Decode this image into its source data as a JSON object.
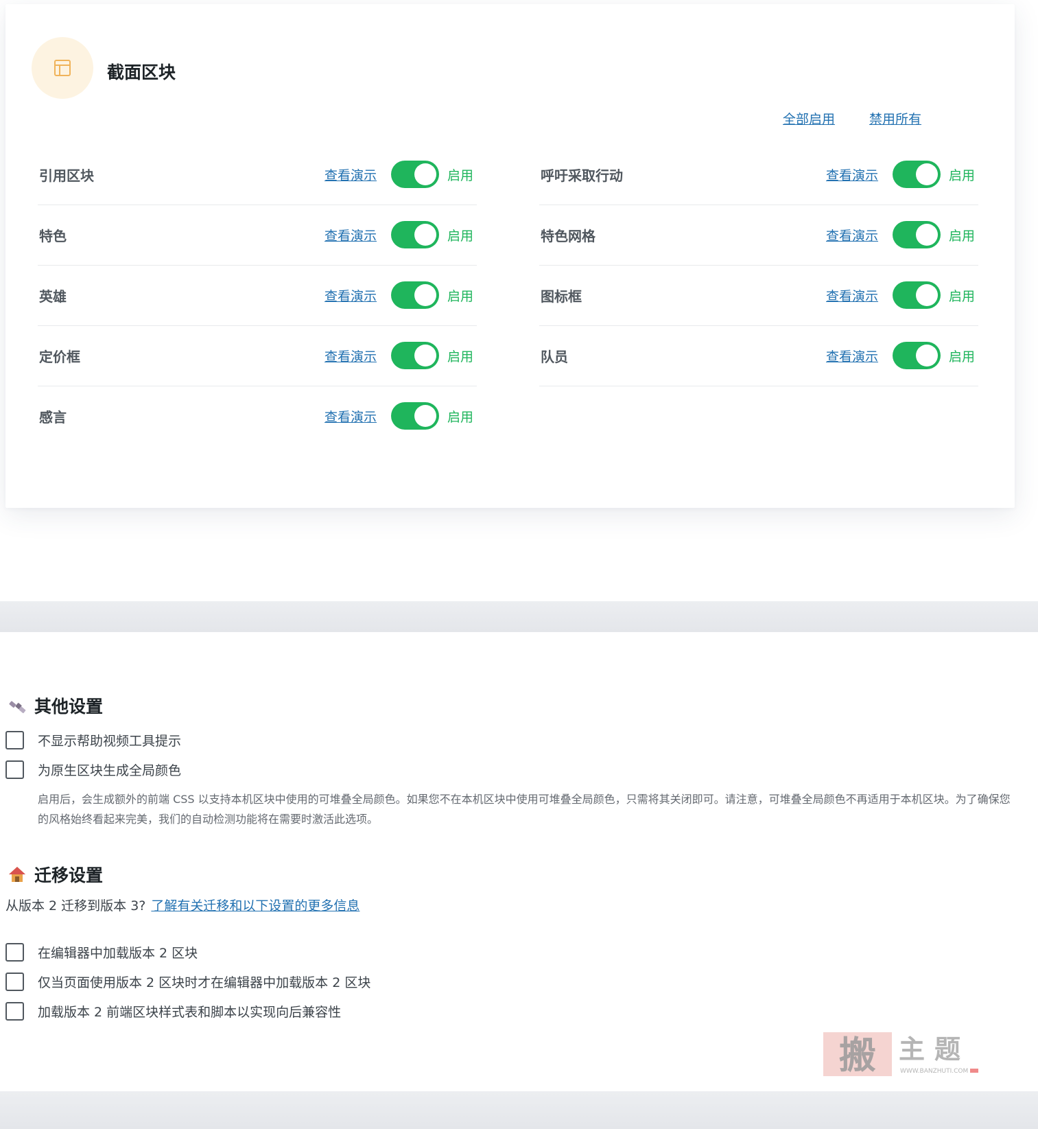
{
  "section_blocks": {
    "title": "截面区块",
    "enable_all": "全部启用",
    "disable_all": "禁用所有",
    "left_blocks": [
      {
        "label": "引用区块",
        "demo": "查看演示",
        "state": "启用",
        "enabled": true
      },
      {
        "label": "特色",
        "demo": "查看演示",
        "state": "启用",
        "enabled": true
      },
      {
        "label": "英雄",
        "demo": "查看演示",
        "state": "启用",
        "enabled": true
      },
      {
        "label": "定价框",
        "demo": "查看演示",
        "state": "启用",
        "enabled": true
      },
      {
        "label": "感言",
        "demo": "查看演示",
        "state": "启用",
        "enabled": true
      }
    ],
    "right_blocks": [
      {
        "label": "呼吁采取行动",
        "demo": "查看演示",
        "state": "启用",
        "enabled": true
      },
      {
        "label": "特色网格",
        "demo": "查看演示",
        "state": "启用",
        "enabled": true
      },
      {
        "label": "图标框",
        "demo": "查看演示",
        "state": "启用",
        "enabled": true
      },
      {
        "label": "队员",
        "demo": "查看演示",
        "state": "启用",
        "enabled": true
      }
    ]
  },
  "other_settings": {
    "title": "其他设置",
    "options": [
      {
        "label": "不显示帮助视频工具提示",
        "checked": false
      },
      {
        "label": "为原生区块生成全局颜色",
        "checked": false
      }
    ],
    "description": "启用后，会生成额外的前端 CSS 以支持本机区块中使用的可堆叠全局颜色。如果您不在本机区块中使用可堆叠全局颜色，只需将其关闭即可。请注意，可堆叠全局颜色不再适用于本机区块。为了确保您的风格始终看起来完美，我们的自动检测功能将在需要时激活此选项。"
  },
  "migration_settings": {
    "title": "迁移设置",
    "intro": "从版本 2 迁移到版本 3?",
    "learn_more": "了解有关迁移和以下设置的更多信息",
    "options": [
      {
        "label": "在编辑器中加载版本 2 区块",
        "checked": false
      },
      {
        "label": "仅当页面使用版本 2 区块时才在编辑器中加载版本 2 区块",
        "checked": false
      },
      {
        "label": "加载版本 2 前端区块样式表和脚本以实现向后兼容性",
        "checked": false
      }
    ]
  },
  "watermark": {
    "brand": "搬主题",
    "url": "WWW.BANZHUTI.COM"
  },
  "colors": {
    "toggle_on": "#1fb55c",
    "link": "#2271b1",
    "icon_bg": "#fdf3e1",
    "icon_stroke": "#f0b35a"
  }
}
